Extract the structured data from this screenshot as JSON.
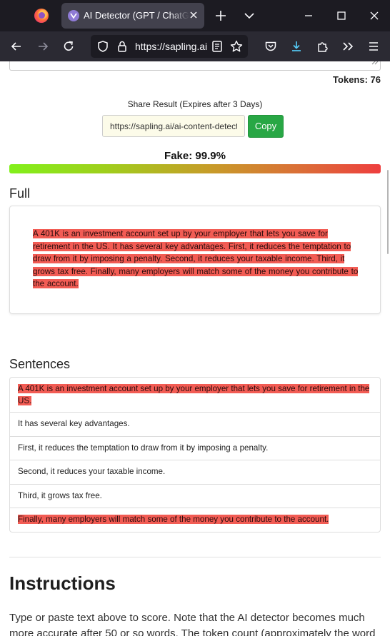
{
  "browser": {
    "tab_title": "AI Detector (GPT / ChatGPT / Claude)",
    "url": "https://sapling.ai/ai-content-detector",
    "url_display": "https://sapling.ai"
  },
  "page": {
    "tokens_label": "Tokens: 76",
    "share": {
      "label": "Share Result (Expires after 3 Days)",
      "link_value": "https://sapling.ai/ai-content-detector?share=",
      "copy_label": "Copy"
    },
    "score_label": "Fake: 99.9%",
    "score_fraction": 0.999,
    "full": {
      "title": "Full",
      "text": "A 401K is an investment account set up by your employer that lets you save for retirement in the US. It has several key advantages. First, it reduces the temptation to draw from it by imposing a penalty. Second, it reduces your taxable income. Third, it grows tax free. Finally, many employers will match some of the money you contribute to the account."
    },
    "sentences": {
      "title": "Sentences",
      "rows": [
        {
          "text": "A 401K is an investment account set up by your employer that lets you save for retirement in the US.",
          "highlighted": true
        },
        {
          "text": "It has several key advantages.",
          "highlighted": false
        },
        {
          "text": "First, it reduces the temptation to draw from it by imposing a penalty.",
          "highlighted": false
        },
        {
          "text": "Second, it reduces your taxable income.",
          "highlighted": false
        },
        {
          "text": "Third, it grows tax free.",
          "highlighted": false
        },
        {
          "text": "Finally, many employers will match some of the money you contribute to the account.",
          "highlighted": true
        }
      ]
    },
    "instructions": {
      "title": "Instructions",
      "text": "Type or paste text above to score. Note that the AI detector becomes much more accurate after 50 or so words. The token count (approximately the word"
    }
  },
  "colors": {
    "highlight": "#f25c54",
    "copy_button": "#28a745",
    "tab_bar": "#1c1b22",
    "nav_bar": "#2b2a33"
  },
  "icons": [
    "firefox-logo-icon",
    "sapling-favicon-icon",
    "close-tab-icon",
    "new-tab-icon",
    "list-all-tabs-icon",
    "minimize-icon",
    "maximize-icon",
    "close-window-icon",
    "back-icon",
    "forward-icon",
    "reload-icon",
    "tracking-protection-icon",
    "lock-icon",
    "reader-view-icon",
    "bookmark-star-icon",
    "pocket-icon",
    "downloads-icon",
    "extensions-icon",
    "overflow-icon",
    "menu-icon"
  ]
}
